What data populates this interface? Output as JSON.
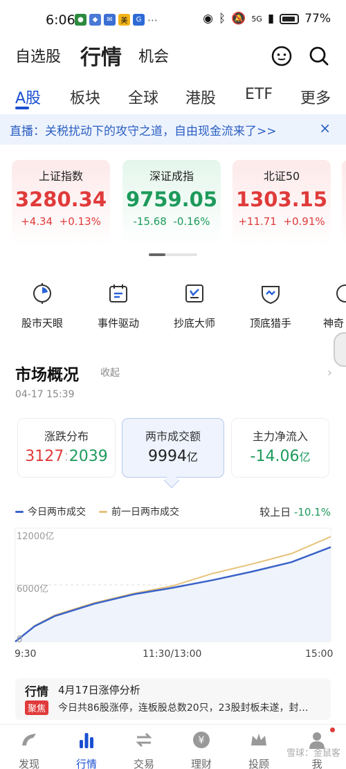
{
  "status_bar": {
    "time": "6:06",
    "battery": "77%",
    "network": "5G"
  },
  "header": {
    "tabs": [
      "自选股",
      "行情",
      "机会"
    ],
    "active": "行情"
  },
  "market_tabs": [
    "A股",
    "板块",
    "全球",
    "港股",
    "ETF",
    "更多"
  ],
  "banner": {
    "text": "直播：关税扰动下的攻守之道，自由现金流来了>>",
    "close": "×"
  },
  "indices": [
    {
      "name": "上证指数",
      "value": "3280.34",
      "change": "+4.34",
      "pct": "+0.13%"
    },
    {
      "name": "深证成指",
      "value": "9759.05",
      "change": "-15.68",
      "pct": "-0.16%"
    },
    {
      "name": "北证50",
      "value": "1303.15",
      "change": "+11.71",
      "pct": "+0.91%"
    }
  ],
  "tools": [
    "股市天眼",
    "事件驱动",
    "抄底大师",
    "顶底猎手",
    "神奇"
  ],
  "overview": {
    "title": "市场概况",
    "collapse": "收起",
    "datetime": "04-17 15:39",
    "updown_label": "涨跌分布",
    "up": "3127",
    "down": "2039",
    "turnover_label": "两市成交额",
    "turnover_value": "9994",
    "turnover_unit": "亿",
    "inflow_label": "主力净流入",
    "inflow_value": "-14.06",
    "inflow_unit": "亿"
  },
  "chart_data": {
    "type": "line",
    "series": [
      {
        "name": "今日两市成交",
        "color": "#3a63c8",
        "x": [
          0,
          15,
          30,
          60,
          90,
          120,
          150,
          180,
          210,
          240
        ],
        "values": [
          0,
          1650,
          2700,
          4000,
          5000,
          5700,
          6500,
          7400,
          8400,
          9994
        ]
      },
      {
        "name": "前一日两市成交",
        "color": "#e6c27a",
        "x": [
          0,
          15,
          30,
          60,
          90,
          120,
          150,
          180,
          210,
          240
        ],
        "values": [
          0,
          1700,
          2800,
          4100,
          5100,
          5900,
          7200,
          8200,
          9300,
          11100
        ]
      }
    ],
    "yticks": [
      "12000亿",
      "6000亿",
      "0"
    ],
    "xticks": [
      "9:30",
      "11:30/13:00",
      "15:00"
    ],
    "ylim": [
      0,
      12000
    ],
    "xlim": [
      0,
      240
    ],
    "compare_label": "较上日",
    "compare_value": "-10.1%"
  },
  "promo": {
    "title": "行情",
    "badge": "聚焦",
    "headline": "4月17日涨停分析",
    "summary": "今日共86股涨停，连板股总数20只，23股封板未遂，封…"
  },
  "tabbar": [
    "发现",
    "行情",
    "交易",
    "理财",
    "投顾",
    "我"
  ],
  "watermark": "雪球：金鼠客"
}
